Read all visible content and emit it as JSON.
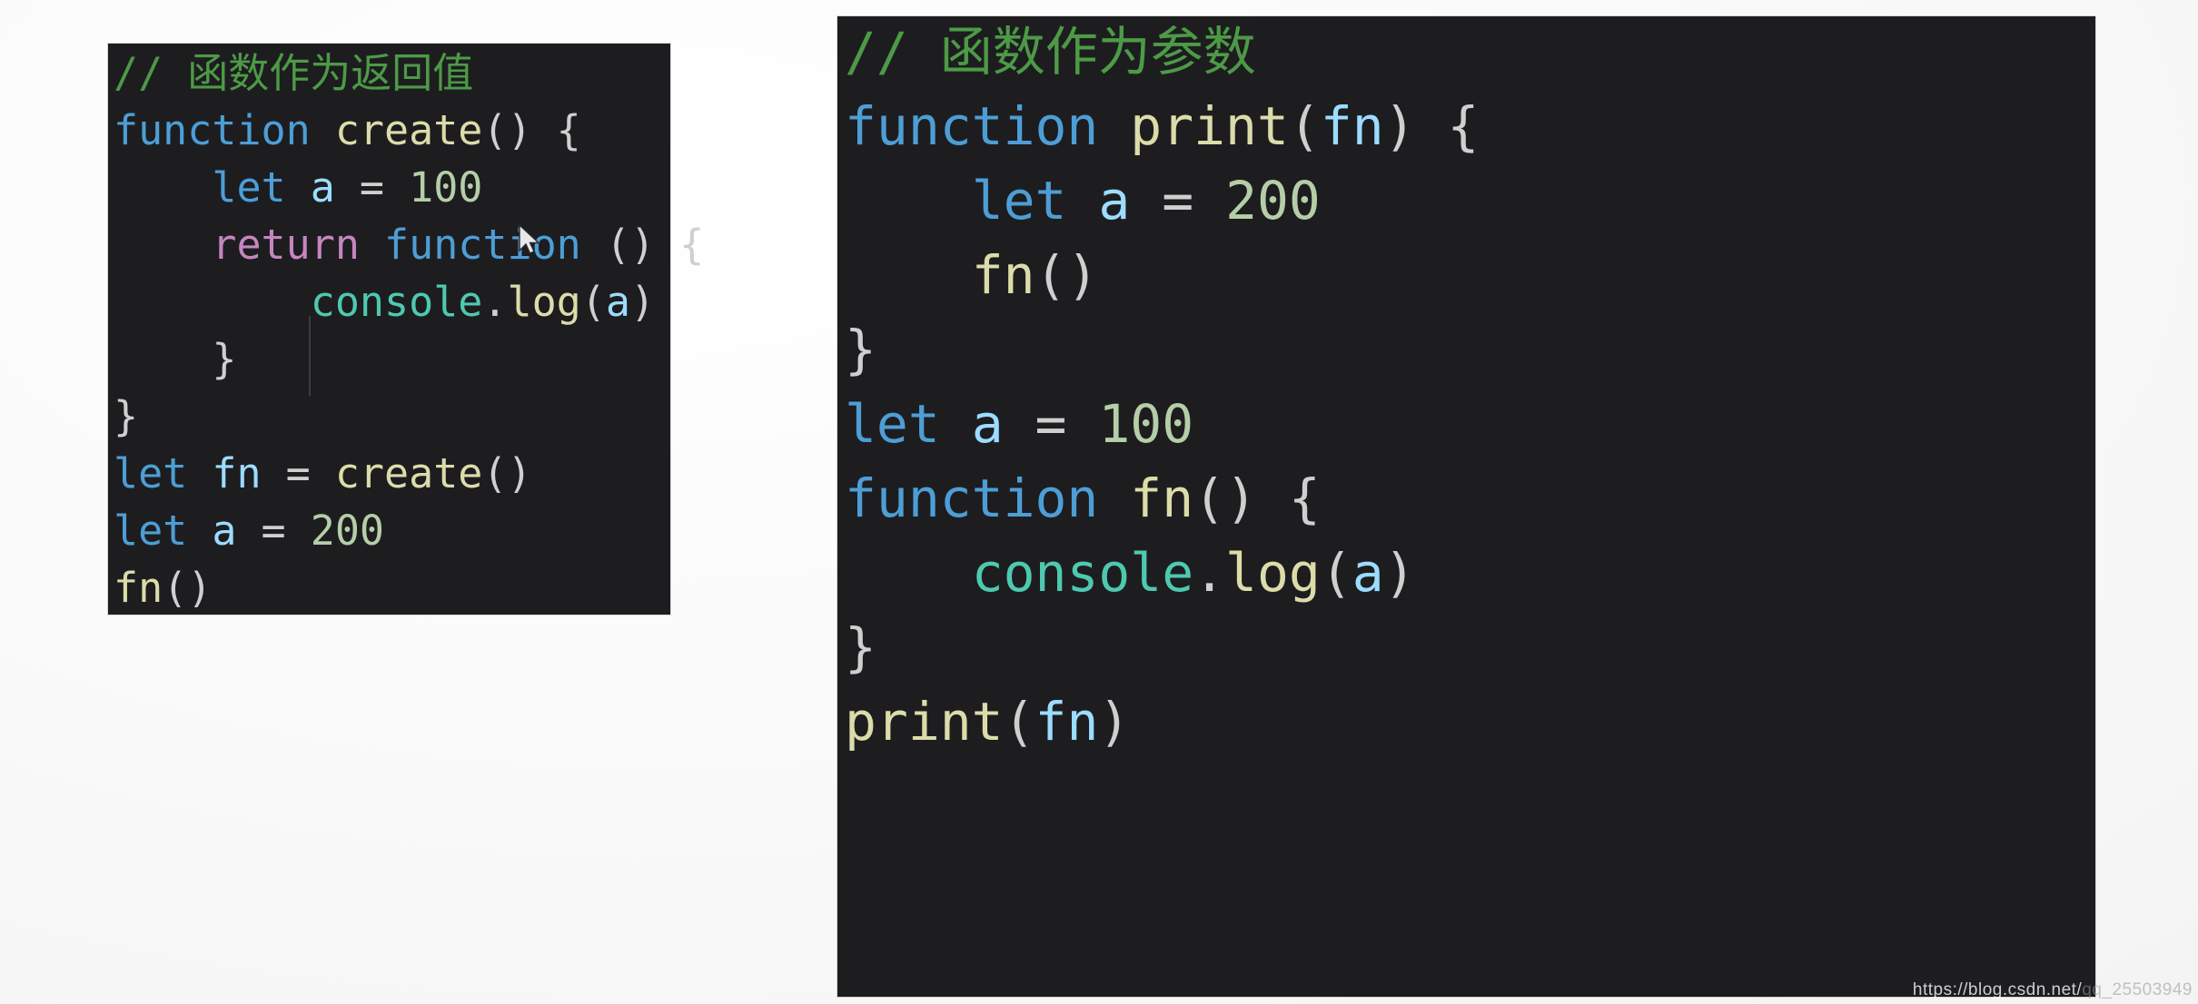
{
  "page": {
    "background_color": "#fbfbfb",
    "watermark_prefix": "https://blog.csdn.net/",
    "watermark_suffix": "qq_25503949"
  },
  "theme": {
    "editor_background": "#1d1d20",
    "comment": "#4d9a46",
    "keyword": "#4d9ed6",
    "function_name": "#dcdcaa",
    "variable": "#9cdcfe",
    "number": "#b5cea8",
    "control_keyword": "#c586c0",
    "object": "#4ec9b0",
    "punctuation": "#d4d4d4"
  },
  "left_panel": {
    "title_comment": "// 函数作为返回值",
    "lines": [
      {
        "id": "l1",
        "indent": 0,
        "tokens": [
          {
            "t": "// 函数作为返回值",
            "c": "t-comment"
          }
        ]
      },
      {
        "id": "l2",
        "indent": 0,
        "tokens": [
          {
            "t": "function ",
            "c": "t-keyword"
          },
          {
            "t": "create",
            "c": "t-fname"
          },
          {
            "t": "() {",
            "c": "t-punct"
          }
        ]
      },
      {
        "id": "l3",
        "indent": 1,
        "tokens": [
          {
            "t": "let ",
            "c": "t-keyword"
          },
          {
            "t": "a",
            "c": "t-var"
          },
          {
            "t": " = ",
            "c": "t-punct"
          },
          {
            "t": "100",
            "c": "t-num"
          }
        ]
      },
      {
        "id": "l4",
        "indent": 1,
        "tokens": [
          {
            "t": "return ",
            "c": "t-return"
          },
          {
            "t": "function ",
            "c": "t-keyword"
          },
          {
            "t": "() {",
            "c": "t-punct"
          }
        ]
      },
      {
        "id": "l5",
        "indent": 2,
        "tokens": [
          {
            "t": "console",
            "c": "t-obj"
          },
          {
            "t": ".",
            "c": "t-punct"
          },
          {
            "t": "log",
            "c": "t-method"
          },
          {
            "t": "(",
            "c": "t-punct"
          },
          {
            "t": "a",
            "c": "t-var"
          },
          {
            "t": ")",
            "c": "t-punct"
          }
        ]
      },
      {
        "id": "l6",
        "indent": 1,
        "tokens": [
          {
            "t": "}",
            "c": "t-punct"
          }
        ]
      },
      {
        "id": "l7",
        "indent": 0,
        "tokens": [
          {
            "t": "}",
            "c": "t-punct"
          }
        ]
      },
      {
        "id": "l8",
        "indent": 0,
        "tokens": [
          {
            "t": "let ",
            "c": "t-keyword"
          },
          {
            "t": "fn",
            "c": "t-var"
          },
          {
            "t": " = ",
            "c": "t-punct"
          },
          {
            "t": "create",
            "c": "t-fname"
          },
          {
            "t": "()",
            "c": "t-punct"
          }
        ]
      },
      {
        "id": "l9",
        "indent": 0,
        "tokens": [
          {
            "t": "let ",
            "c": "t-keyword"
          },
          {
            "t": "a",
            "c": "t-var"
          },
          {
            "t": " = ",
            "c": "t-punct"
          },
          {
            "t": "200",
            "c": "t-num"
          }
        ]
      },
      {
        "id": "l10",
        "indent": 0,
        "tokens": [
          {
            "t": "fn",
            "c": "t-fname"
          },
          {
            "t": "()",
            "c": "t-punct"
          }
        ]
      }
    ]
  },
  "right_panel": {
    "title_comment": "// 函数作为参数",
    "lines": [
      {
        "id": "r1",
        "indent": 0,
        "tokens": [
          {
            "t": "// 函数作为参数",
            "c": "t-comment"
          }
        ]
      },
      {
        "id": "r2",
        "indent": 0,
        "tokens": [
          {
            "t": "function ",
            "c": "t-keyword"
          },
          {
            "t": "print",
            "c": "t-fname"
          },
          {
            "t": "(",
            "c": "t-punct"
          },
          {
            "t": "fn",
            "c": "t-var"
          },
          {
            "t": ") {",
            "c": "t-punct"
          }
        ]
      },
      {
        "id": "r3",
        "indent": 1,
        "tokens": [
          {
            "t": "let ",
            "c": "t-keyword"
          },
          {
            "t": "a",
            "c": "t-var"
          },
          {
            "t": " = ",
            "c": "t-punct"
          },
          {
            "t": "200",
            "c": "t-num"
          }
        ]
      },
      {
        "id": "r4",
        "indent": 1,
        "tokens": [
          {
            "t": "fn",
            "c": "t-fname"
          },
          {
            "t": "()",
            "c": "t-punct"
          }
        ]
      },
      {
        "id": "r5",
        "indent": 0,
        "tokens": [
          {
            "t": "}",
            "c": "t-punct"
          }
        ]
      },
      {
        "id": "r6",
        "indent": 0,
        "tokens": [
          {
            "t": "let ",
            "c": "t-keyword"
          },
          {
            "t": "a",
            "c": "t-var"
          },
          {
            "t": " = ",
            "c": "t-punct"
          },
          {
            "t": "100",
            "c": "t-num"
          }
        ]
      },
      {
        "id": "r7",
        "indent": 0,
        "tokens": [
          {
            "t": "function ",
            "c": "t-keyword"
          },
          {
            "t": "fn",
            "c": "t-fname"
          },
          {
            "t": "() {",
            "c": "t-punct"
          }
        ]
      },
      {
        "id": "r8",
        "indent": 1,
        "tokens": [
          {
            "t": "console",
            "c": "t-obj"
          },
          {
            "t": ".",
            "c": "t-punct"
          },
          {
            "t": "log",
            "c": "t-method"
          },
          {
            "t": "(",
            "c": "t-punct"
          },
          {
            "t": "a",
            "c": "t-var"
          },
          {
            "t": ")",
            "c": "t-punct"
          }
        ]
      },
      {
        "id": "r9",
        "indent": 0,
        "tokens": [
          {
            "t": "}",
            "c": "t-punct"
          }
        ]
      },
      {
        "id": "r10",
        "indent": 0,
        "tokens": [
          {
            "t": "print",
            "c": "t-fname"
          },
          {
            "t": "(",
            "c": "t-punct"
          },
          {
            "t": "fn",
            "c": "t-var"
          },
          {
            "t": ")",
            "c": "t-punct"
          }
        ]
      }
    ]
  }
}
